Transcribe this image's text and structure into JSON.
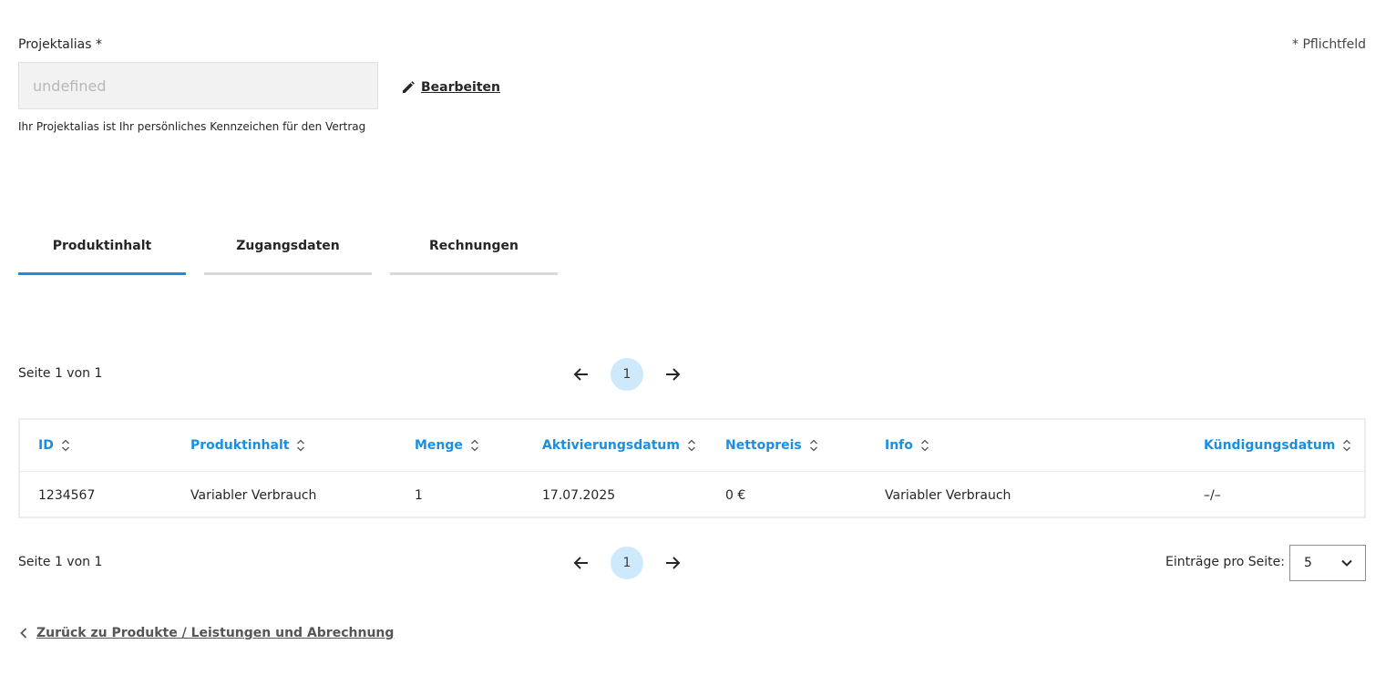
{
  "alias": {
    "label": "Projektalias *",
    "required_note": "* Pflichtfeld",
    "value": "undefined",
    "edit_label": "Bearbeiten",
    "hint": "Ihr Projektalias ist Ihr persönliches Kennzeichen für den Vertrag"
  },
  "tabs": [
    {
      "label": "Produktinhalt",
      "active": true
    },
    {
      "label": "Zugangsdaten",
      "active": false
    },
    {
      "label": "Rechnungen",
      "active": false
    }
  ],
  "pagination": {
    "page_info": "Seite 1 von 1",
    "current_page": "1"
  },
  "table": {
    "columns": [
      "ID",
      "Produktinhalt",
      "Menge",
      "Aktivierungsdatum",
      "Nettopreis",
      "Info",
      "Kündigungsdatum"
    ],
    "rows": [
      [
        "1234567",
        "Variabler Verbrauch",
        "1",
        "17.07.2025",
        "0 €",
        "Variabler Verbrauch",
        "–/–"
      ]
    ]
  },
  "entries_per_page": {
    "label": "Einträge pro Seite:",
    "value": "5"
  },
  "back_link": "Zurück zu Produkte / Leistungen und Abrechnung",
  "colors": {
    "accent": "#1a8fe0",
    "page_bubble": "#cde9fb",
    "inactive_tab": "#d9d9d9"
  }
}
